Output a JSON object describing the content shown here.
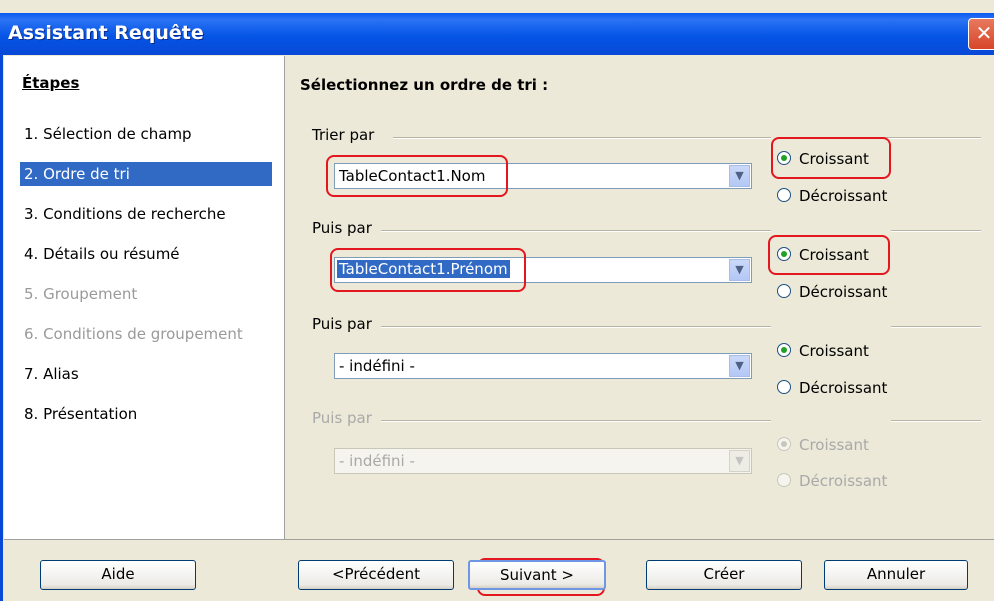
{
  "window": {
    "title": "Assistant Requête",
    "close_glyph": "✕"
  },
  "sidebar": {
    "title": "Étapes",
    "steps": [
      {
        "label": "1.  Sélection de champ",
        "state": "normal"
      },
      {
        "label": "2.  Ordre de tri",
        "state": "active"
      },
      {
        "label": "3.  Conditions de recherche",
        "state": "normal"
      },
      {
        "label": "4.  Détails ou résumé",
        "state": "normal"
      },
      {
        "label": "5.  Groupement",
        "state": "disabled"
      },
      {
        "label": "6.  Conditions de groupement",
        "state": "disabled"
      },
      {
        "label": "7.  Alias",
        "state": "normal"
      },
      {
        "label": "8.  Présentation",
        "state": "normal"
      }
    ]
  },
  "main": {
    "heading": "Sélectionnez un ordre de tri :",
    "groups": [
      {
        "label": "Trier par",
        "value": "TableContact1.Nom",
        "ascending": "Croissant",
        "descending": "Décroissant",
        "selected": "ascending",
        "enabled": true
      },
      {
        "label": "Puis par",
        "value": "TableContact1.Prénom",
        "ascending": "Croissant",
        "descending": "Décroissant",
        "selected": "ascending",
        "enabled": true
      },
      {
        "label": "Puis par",
        "value": "- indéfini -",
        "ascending": "Croissant",
        "descending": "Décroissant",
        "selected": "ascending",
        "enabled": true
      },
      {
        "label": "Puis par",
        "value": "- indéfini -",
        "ascending": "Croissant",
        "descending": "Décroissant",
        "selected": "ascending",
        "enabled": false
      }
    ],
    "dropdown_arrow": "▼"
  },
  "buttons": {
    "help": "Aide",
    "previous": "<Précédent",
    "next": "Suivant >",
    "create": "Créer",
    "cancel": "Annuler"
  },
  "colors": {
    "titlebar": "#0555E6",
    "selection": "#316AC5",
    "highlight_annotation": "#E4161E",
    "radio_on": "#21A121"
  }
}
